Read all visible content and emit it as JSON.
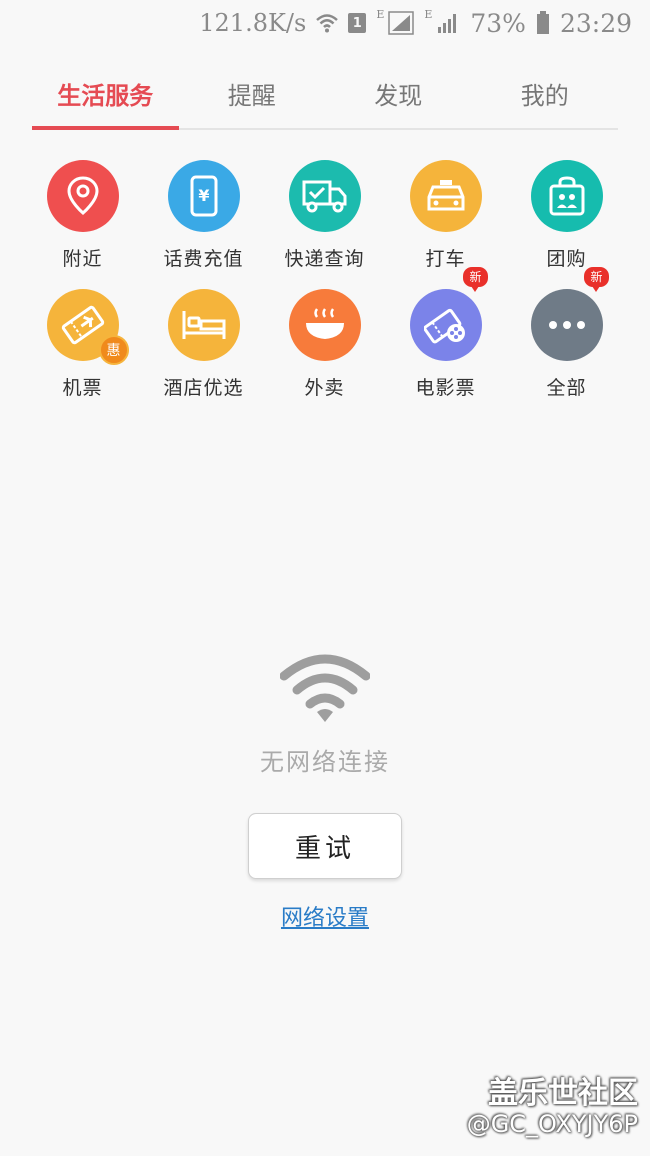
{
  "status_bar": {
    "speed": "121.8K/s",
    "sim": "1",
    "net_type_1": "E",
    "net_type_2": "E",
    "battery": "73%",
    "time": "23:29",
    "icons": [
      "wifi-icon",
      "signal-icon",
      "signal-icon",
      "battery-icon"
    ]
  },
  "tabs": [
    {
      "label": "生活服务",
      "active": true
    },
    {
      "label": "提醒",
      "active": false
    },
    {
      "label": "发现",
      "active": false
    },
    {
      "label": "我的",
      "active": false
    }
  ],
  "services": [
    {
      "label": "附近",
      "icon": "location-pin-icon",
      "color": "#ef4f4f"
    },
    {
      "label": "话费充值",
      "icon": "phone-yuan-icon",
      "color": "#3aa9e6"
    },
    {
      "label": "快递查询",
      "icon": "delivery-truck-icon",
      "color": "#1cbbae"
    },
    {
      "label": "打车",
      "icon": "taxi-icon",
      "color": "#f5b43b"
    },
    {
      "label": "团购",
      "icon": "group-bag-icon",
      "color": "#16bcae"
    },
    {
      "label": "机票",
      "icon": "plane-ticket-icon",
      "color": "#f5b43b",
      "badge": "惠"
    },
    {
      "label": "酒店优选",
      "icon": "bed-icon",
      "color": "#f5b43b"
    },
    {
      "label": "外卖",
      "icon": "food-bowl-icon",
      "color": "#f77b3b"
    },
    {
      "label": "电影票",
      "icon": "movie-ticket-icon",
      "color": "#7b83e9",
      "badge": "新"
    },
    {
      "label": "全部",
      "icon": "more-dots-icon",
      "color": "#6f7b87",
      "badge": "新"
    }
  ],
  "no_network": {
    "message": "无网络连接",
    "retry_label": "重试",
    "settings_link": "网络设置"
  },
  "watermark": {
    "title": "盖乐世社区",
    "user": "@GC_OXYJY6P"
  }
}
